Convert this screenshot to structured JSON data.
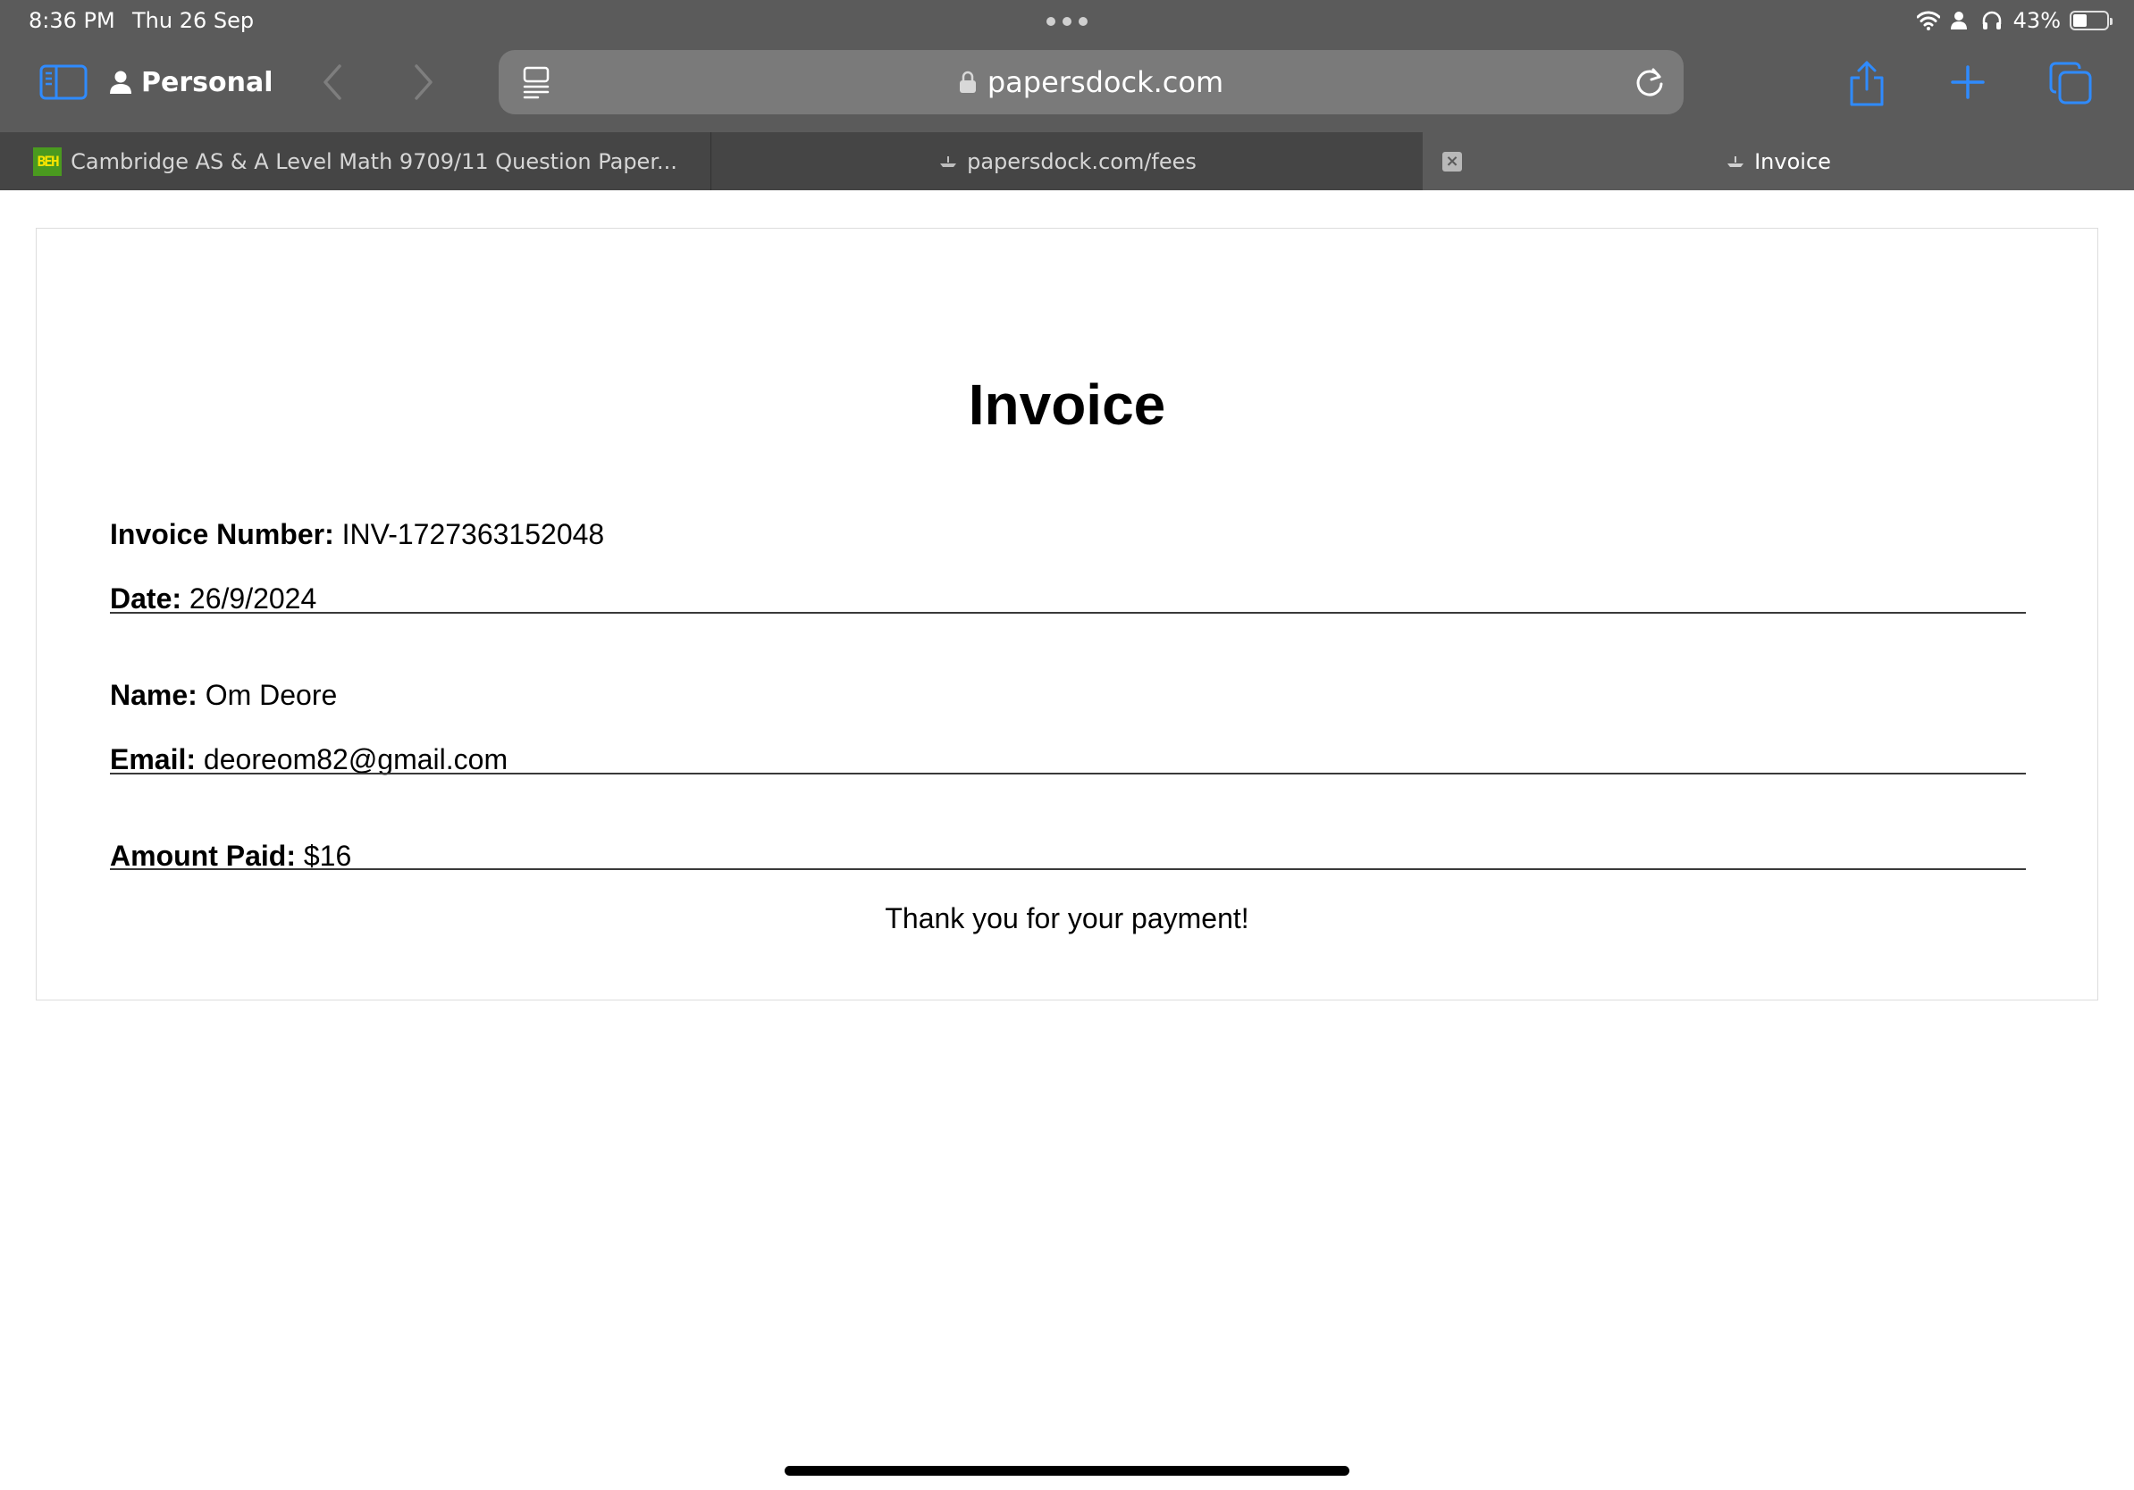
{
  "status_bar": {
    "time": "8:36 PM",
    "date": "Thu 26 Sep",
    "battery_percent": "43%",
    "battery_level": 0.43,
    "icons": [
      "wifi-icon",
      "person-icon",
      "headphones-icon",
      "battery-icon"
    ]
  },
  "toolbar": {
    "profile_label": "Personal",
    "icons": [
      "sidebar-icon",
      "person-icon",
      "back-chevron-icon",
      "forward-chevron-icon",
      "reader-icon",
      "lock-icon",
      "reload-icon",
      "share-icon",
      "plus-icon",
      "tabs-overview-icon"
    ]
  },
  "address_bar": {
    "url": "papersdock.com"
  },
  "tabs": [
    {
      "label": "Cambridge AS & A Level Math 9709/11 Question Paper...",
      "favicon": "BEH"
    },
    {
      "label": "papersdock.com/fees"
    },
    {
      "label": "Invoice",
      "active": true
    }
  ],
  "invoice": {
    "title": "Invoice",
    "invoice_number_label": "Invoice Number:",
    "invoice_number": "INV-1727363152048",
    "date_label": "Date:",
    "date": "26/9/2024",
    "name_label": "Name:",
    "name": "Om Deore",
    "email_label": "Email:",
    "email": "deoreom82@gmail.com",
    "amount_label": "Amount Paid:",
    "amount": "$16",
    "thanks": "Thank you for your payment!"
  },
  "colors": {
    "chrome_bg": "#5b5b5b",
    "tabstrip_bg": "#454545",
    "address_bg": "#7a7a7a",
    "accent_blue": "#2f8bff"
  }
}
